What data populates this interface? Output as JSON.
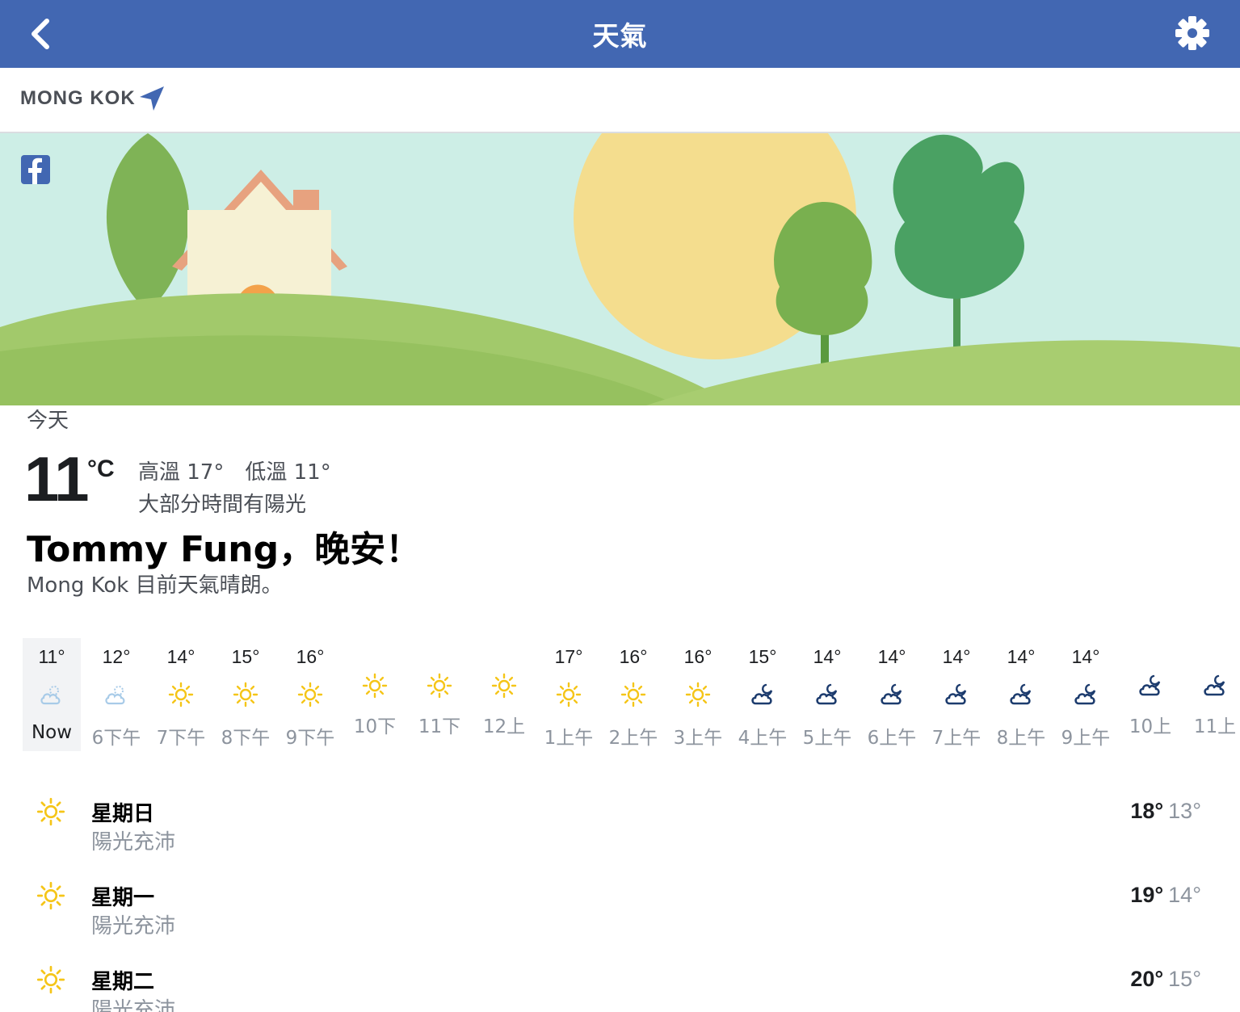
{
  "nav": {
    "title": "天氣"
  },
  "location": {
    "name": "MONG KOK"
  },
  "today": {
    "label": "今天",
    "temp": "11",
    "unit": "°C",
    "high": "高溫 17°",
    "low": "低溫 11°",
    "condition": "大部分時間有陽光",
    "greeting": "Tommy Fung，晚安！",
    "summary": "Mong Kok 目前天氣晴朗。"
  },
  "colors": {
    "navbar": "#4267b2",
    "sun": "#f5c518",
    "cloud": "#1d3c6e",
    "now_bg": "#f2f3f5"
  },
  "hourly": [
    {
      "temp": "11°",
      "label": "Now",
      "icon": "partly-cloudy-icon"
    },
    {
      "temp": "12°",
      "label": "6下午",
      "icon": "partly-cloudy-icon"
    },
    {
      "temp": "14°",
      "label": "7下午",
      "icon": "sun-icon"
    },
    {
      "temp": "15°",
      "label": "8下午",
      "icon": "sun-icon"
    },
    {
      "temp": "16°",
      "label": "9下午",
      "icon": "sun-icon"
    },
    {
      "temp": "",
      "label": "10下",
      "icon": "sun-icon"
    },
    {
      "temp": "",
      "label": "11下",
      "icon": "sun-icon"
    },
    {
      "temp": "",
      "label": "12上",
      "icon": "sun-icon"
    },
    {
      "temp": "17°",
      "label": "1上午",
      "icon": "sun-icon"
    },
    {
      "temp": "16°",
      "label": "2上午",
      "icon": "sun-icon"
    },
    {
      "temp": "16°",
      "label": "3上午",
      "icon": "sun-icon"
    },
    {
      "temp": "15°",
      "label": "4上午",
      "icon": "cloudy-night-icon"
    },
    {
      "temp": "14°",
      "label": "5上午",
      "icon": "cloudy-night-icon"
    },
    {
      "temp": "14°",
      "label": "6上午",
      "icon": "cloudy-night-icon"
    },
    {
      "temp": "14°",
      "label": "7上午",
      "icon": "cloudy-night-icon"
    },
    {
      "temp": "14°",
      "label": "8上午",
      "icon": "cloudy-night-icon"
    },
    {
      "temp": "14°",
      "label": "9上午",
      "icon": "cloudy-night-icon"
    },
    {
      "temp": "",
      "label": "10上",
      "icon": "cloudy-night-icon"
    },
    {
      "temp": "",
      "label": "11上",
      "icon": "cloudy-night-icon"
    }
  ],
  "daily": [
    {
      "day": "星期日",
      "condition": "陽光充沛",
      "high": "18°",
      "low": "13°",
      "icon": "sun-icon"
    },
    {
      "day": "星期一",
      "condition": "陽光充沛",
      "high": "19°",
      "low": "14°",
      "icon": "sun-icon"
    },
    {
      "day": "星期二",
      "condition": "陽光充沛",
      "high": "20°",
      "low": "15°",
      "icon": "sun-icon"
    }
  ]
}
